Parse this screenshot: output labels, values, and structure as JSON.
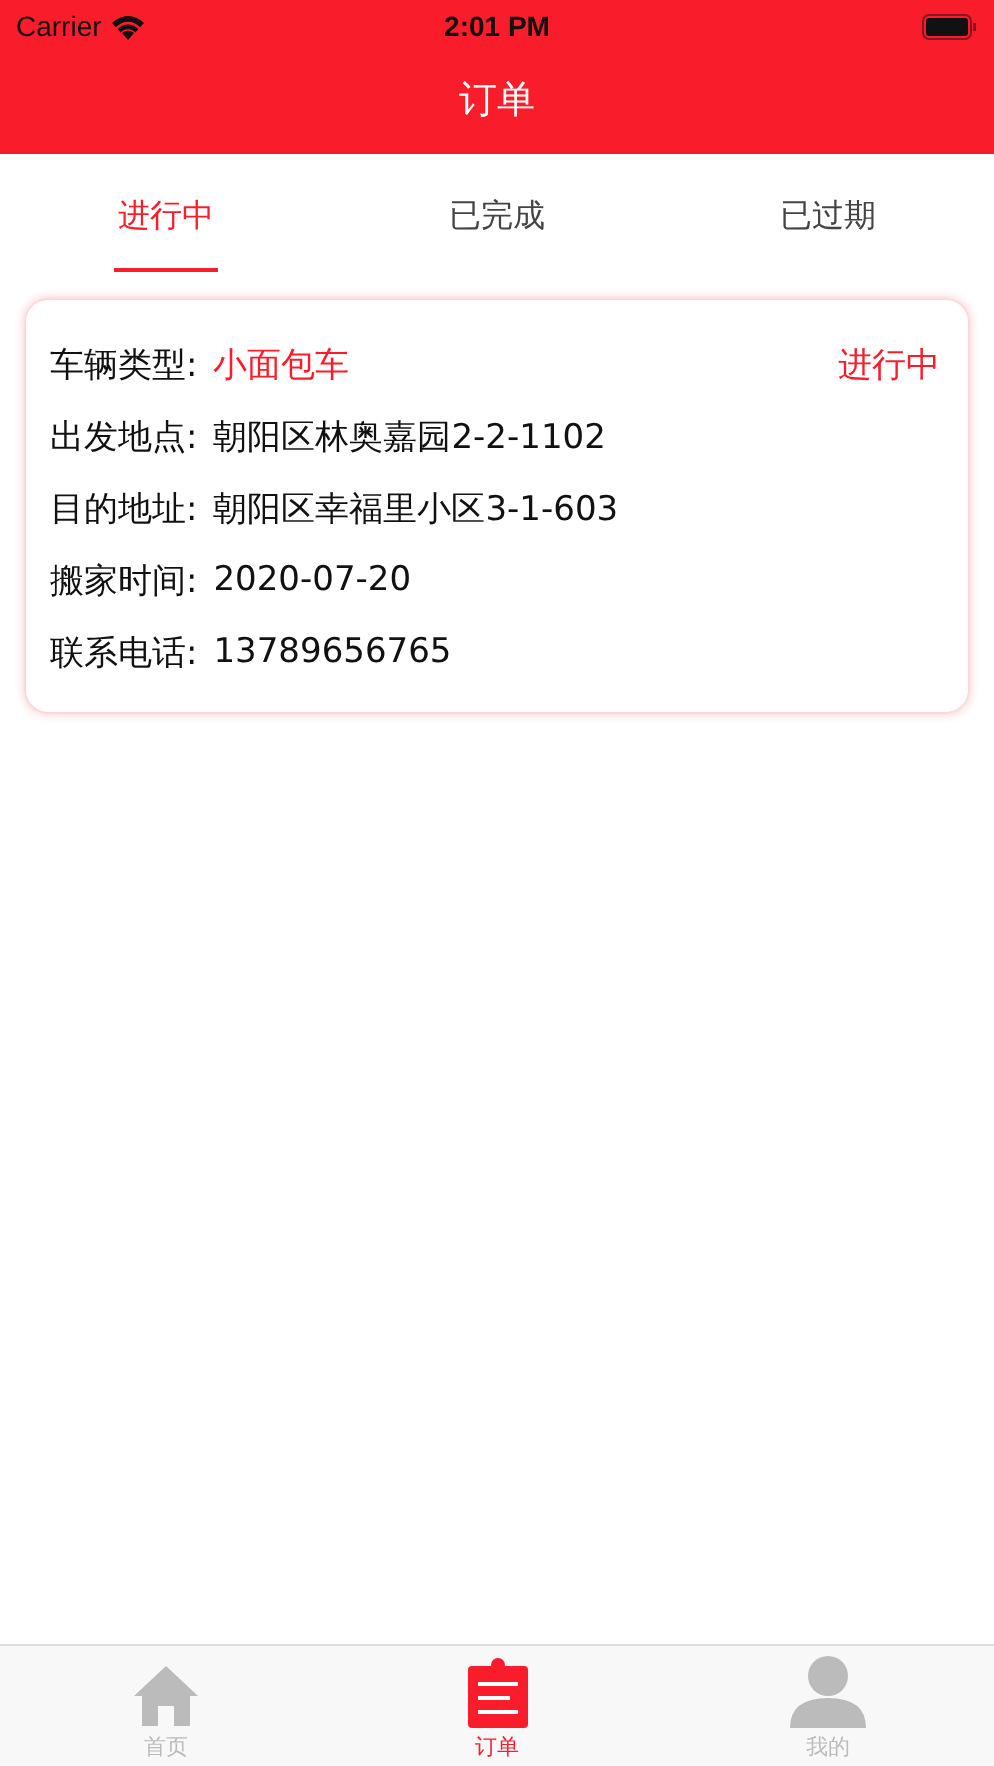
{
  "status_bar": {
    "carrier": "Carrier",
    "time": "2:01 PM"
  },
  "header": {
    "title": "订单"
  },
  "tabs": [
    {
      "label": "进行中",
      "selected": true
    },
    {
      "label": "已完成",
      "selected": false
    },
    {
      "label": "已过期",
      "selected": false
    }
  ],
  "orders": [
    {
      "status": "进行中",
      "fields": [
        {
          "label": "车辆类型:",
          "value": "小面包车",
          "highlight": true
        },
        {
          "label": "出发地点:",
          "value": "朝阳区林奥嘉园2-2-1102",
          "highlight": false
        },
        {
          "label": "目的地址:",
          "value": "朝阳区幸福里小区3-1-603",
          "highlight": false
        },
        {
          "label": "搬家时间:",
          "value": "2020-07-20",
          "highlight": false
        },
        {
          "label": "联系电话:",
          "value": "13789656765",
          "highlight": false
        }
      ]
    }
  ],
  "tab_bar": [
    {
      "kind": "home",
      "label": "首页",
      "selected": false
    },
    {
      "kind": "orders",
      "label": "订单",
      "selected": true
    },
    {
      "kind": "profile",
      "label": "我的",
      "selected": false
    }
  ]
}
